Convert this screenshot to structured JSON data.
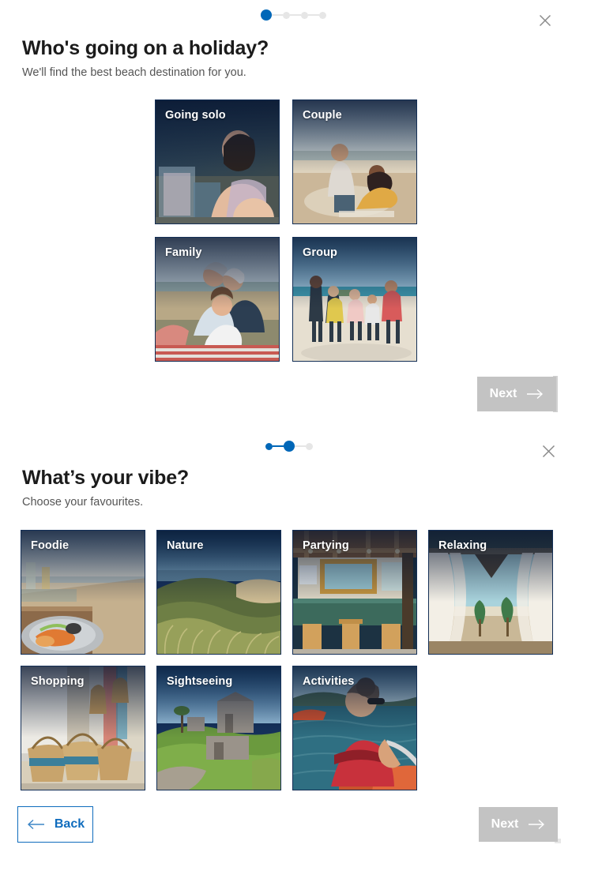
{
  "theme": {
    "accent": "#0067b8",
    "link_blue": "#0f6cbd",
    "disabled_gray": "#c3c3c3",
    "heading_color": "#1b1b1b",
    "sub_color": "#555555",
    "close_color": "#8a8a8a"
  },
  "step1": {
    "stepper": {
      "total": 4,
      "current": 1,
      "dots": [
        "active",
        "inactive",
        "inactive",
        "inactive"
      ]
    },
    "close_label": "close-icon",
    "title": "Who's going on a holiday?",
    "subtitle": "We'll find the best beach destination for you.",
    "cards": [
      {
        "label": "Going solo",
        "image": "woman-relaxing-beach-bar-photo"
      },
      {
        "label": "Couple",
        "image": "couple-sitting-on-beach-photo"
      },
      {
        "label": "Family",
        "image": "family-on-beach-blanket-photo"
      },
      {
        "label": "Group",
        "image": "group-playing-on-beach-photo"
      }
    ],
    "next_label": "Next",
    "next_icon": "arrow-right-icon",
    "next_disabled": true
  },
  "step2": {
    "stepper": {
      "total": 3,
      "current": 2,
      "dots": [
        "done",
        "active",
        "inactive"
      ]
    },
    "close_label": "close-icon",
    "title": "What’s your vibe?",
    "subtitle": "Choose your favourites.",
    "cards": [
      {
        "label": "Foodie",
        "image": "seafood-plate-beach-photo"
      },
      {
        "label": "Nature",
        "image": "coastal-dunes-grass-photo"
      },
      {
        "label": "Partying",
        "image": "beach-bar-stools-photo"
      },
      {
        "label": "Relaxing",
        "image": "beach-cabana-curtains-photo"
      },
      {
        "label": "Shopping",
        "image": "market-baskets-stall-photo"
      },
      {
        "label": "Sightseeing",
        "image": "stone-ruins-on-hill-photo"
      },
      {
        "label": "Activities",
        "image": "woman-kayaking-photo"
      }
    ],
    "back_label": "Back",
    "back_icon": "arrow-left-icon",
    "next_label": "Next",
    "next_icon": "arrow-right-icon",
    "next_disabled": true
  }
}
